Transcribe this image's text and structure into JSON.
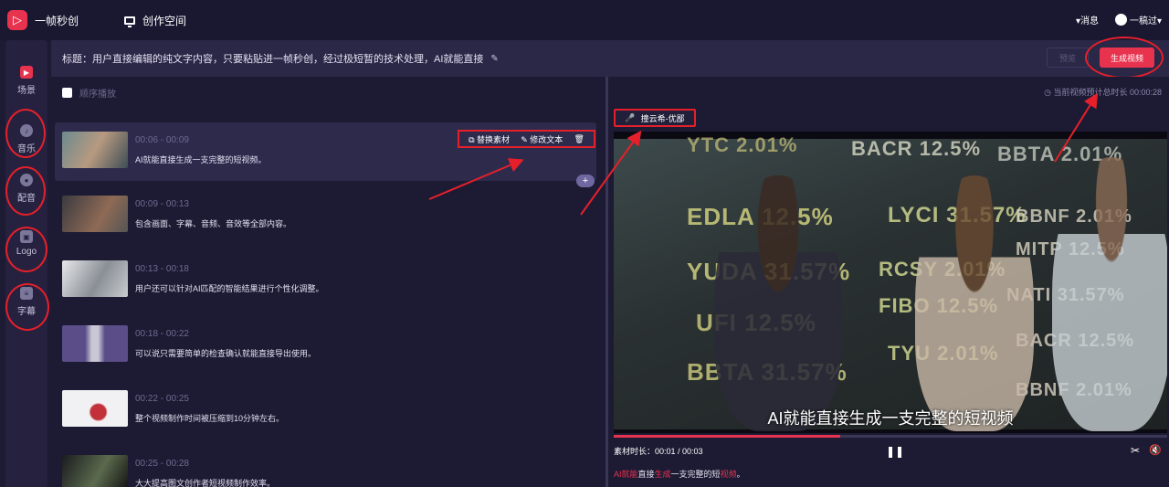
{
  "app": {
    "name": "一帧秒创",
    "workspace": "创作空间"
  },
  "header": {
    "messages": "消息",
    "user": "一稿过"
  },
  "sidebar": {
    "items": [
      {
        "label": "场景",
        "icon": "scene-icon"
      },
      {
        "label": "音乐",
        "icon": "music-icon"
      },
      {
        "label": "配音",
        "icon": "dubbing-icon"
      },
      {
        "label": "Logo",
        "icon": "logo-icon"
      },
      {
        "label": "字幕",
        "icon": "subtitle-icon"
      }
    ]
  },
  "titlebar": {
    "title": "标题：用户直接编辑的纯文字内容，只要粘贴进一帧秒创，经过极短暂的技术处理，AI就能直接",
    "preview_label": "预览",
    "generate_label": "生成视频"
  },
  "scenes": {
    "order_label": "顺序播放",
    "actions": {
      "replace": "替换素材",
      "edit": "修改文本"
    },
    "add_label": "+",
    "items": [
      {
        "time": "00:06 - 00:09",
        "text": "AI就能直接生成一支完整的短视频。"
      },
      {
        "time": "00:09 - 00:13",
        "text": "包含画面、字幕、音频、音效等全部内容。"
      },
      {
        "time": "00:13 - 00:18",
        "text": "用户还可以针对AI匹配的智能结果进行个性化调整。"
      },
      {
        "time": "00:18 - 00:22",
        "text": "可以说只需要简单的检查确认就能直接导出使用。"
      },
      {
        "time": "00:22 - 00:25",
        "text": "整个视频制作时间被压缩到10分钟左右。"
      },
      {
        "time": "00:25 - 00:28",
        "text": "大大提高图文创作者短视频制作效率。"
      }
    ]
  },
  "preview": {
    "estimate": "当前视频预计总时长 00:00:28",
    "voice": "撞云希-优鄙",
    "subtitle": "AI就能直接生成一支完整的短视频",
    "duration_label": "素材时长：00:01 / 00:03",
    "progress": 0.41,
    "caption": {
      "p1": "AI就能",
      "p2": "直接",
      "p3": "生成",
      "p4": "一支完整的短",
      "p5": "视频",
      "p6": "。"
    }
  },
  "colors": {
    "accent": "#e8334f",
    "annotation": "#e5202a"
  }
}
